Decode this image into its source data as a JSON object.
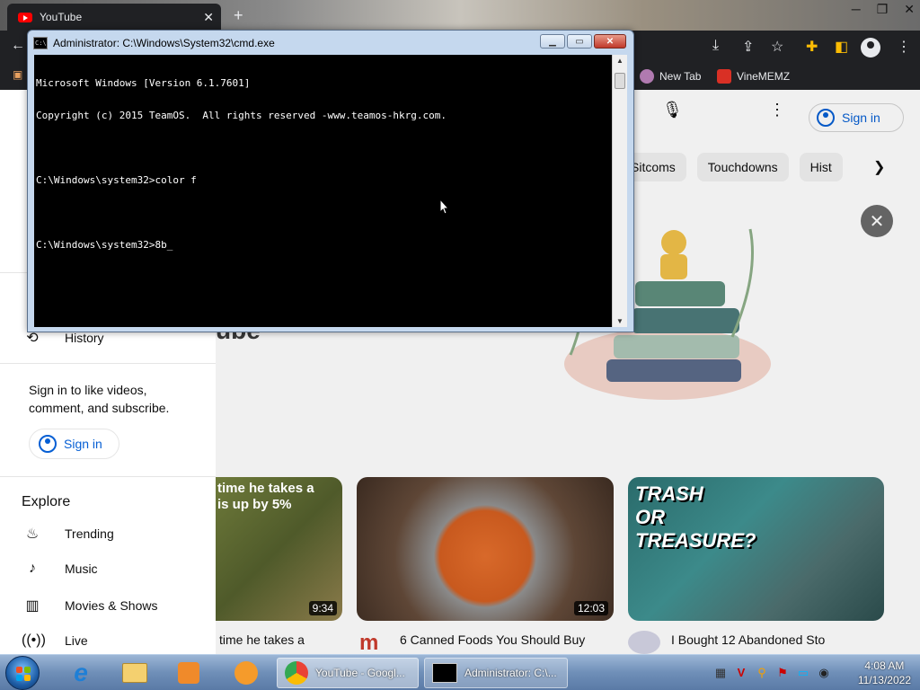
{
  "browser": {
    "tab_title": "YouTube",
    "tab_close": "✕",
    "new_tab": "+",
    "bookmarks": [
      {
        "label": "New Tab",
        "color": "#e8eaed"
      },
      {
        "label": "VineMEMZ",
        "color": "#d93025"
      }
    ]
  },
  "youtube": {
    "signin_label": "Sign in",
    "chips": [
      "Sitcoms",
      "Touchdowns",
      "Hist"
    ],
    "headline_fragment": "ube",
    "sidebar": {
      "history": "History",
      "signin_prompt": "Sign in to like videos, comment, and subscribe.",
      "signin_button": "Sign in",
      "explore": "Explore",
      "explore_items": [
        {
          "label": "Trending",
          "icon": "flame-icon"
        },
        {
          "label": "Music",
          "icon": "music-note-icon"
        },
        {
          "label": "Movies & Shows",
          "icon": "film-icon"
        },
        {
          "label": "Live",
          "icon": "live-icon"
        }
      ]
    },
    "videos": [
      {
        "thumb_caption": "time he takes a\nis up by 5%",
        "duration": "9:34",
        "title": "time he takes a"
      },
      {
        "thumb_caption": "",
        "duration": "12:03",
        "title": "6 Canned Foods You Should Buy"
      },
      {
        "thumb_caption": "TRASH\nOR\nTREASURE?",
        "duration": "",
        "title": "I Bought 12 Abandoned Sto"
      }
    ]
  },
  "cmd": {
    "title": "Administrator: C:\\Windows\\System32\\cmd.exe",
    "lines": [
      "Microsoft Windows [Version 6.1.7601]",
      "Copyright (c) 2015 TeamOS.  All rights reserved -www.teamos-hkrg.com.",
      "",
      "C:\\Windows\\system32>color f",
      "",
      "C:\\Windows\\system32>8b"
    ]
  },
  "taskbar": {
    "tasks": [
      {
        "label": "YouTube - Googl...",
        "icon": "chrome-icon"
      },
      {
        "label": "Administrator: C:\\...",
        "icon": "cmd-icon"
      }
    ],
    "time": "4:08 AM",
    "date": "11/13/2022"
  }
}
